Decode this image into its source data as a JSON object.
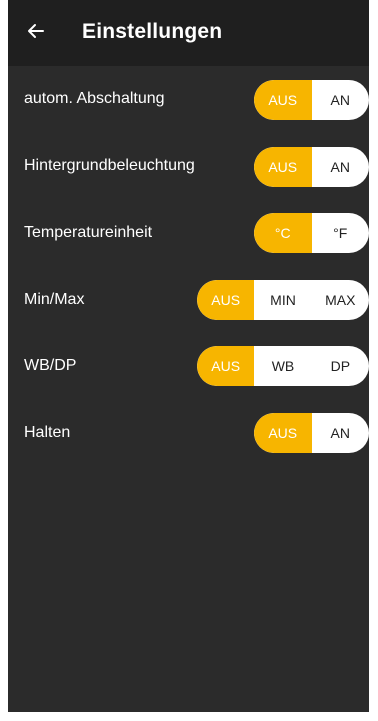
{
  "header": {
    "title": "Einstellungen",
    "back_icon": "arrow-left-icon"
  },
  "colors": {
    "accent": "#f7b500",
    "background": "#2b2b2b",
    "appbar": "#1f1f1f",
    "toggle_bg": "#ffffff"
  },
  "settings": [
    {
      "label": "autom. Abschaltung",
      "options": [
        "AUS",
        "AN"
      ],
      "selected": "AUS"
    },
    {
      "label": "Hintergrundbeleuchtung",
      "options": [
        "AUS",
        "AN"
      ],
      "selected": "AUS"
    },
    {
      "label": "Temperatureinheit",
      "options": [
        "°C",
        "°F"
      ],
      "selected": "°C"
    },
    {
      "label": "Min/Max",
      "options": [
        "AUS",
        "MIN",
        "MAX"
      ],
      "selected": "AUS"
    },
    {
      "label": "WB/DP",
      "options": [
        "AUS",
        "WB",
        "DP"
      ],
      "selected": "AUS"
    },
    {
      "label": "Halten",
      "options": [
        "AUS",
        "AN"
      ],
      "selected": "AUS"
    }
  ]
}
